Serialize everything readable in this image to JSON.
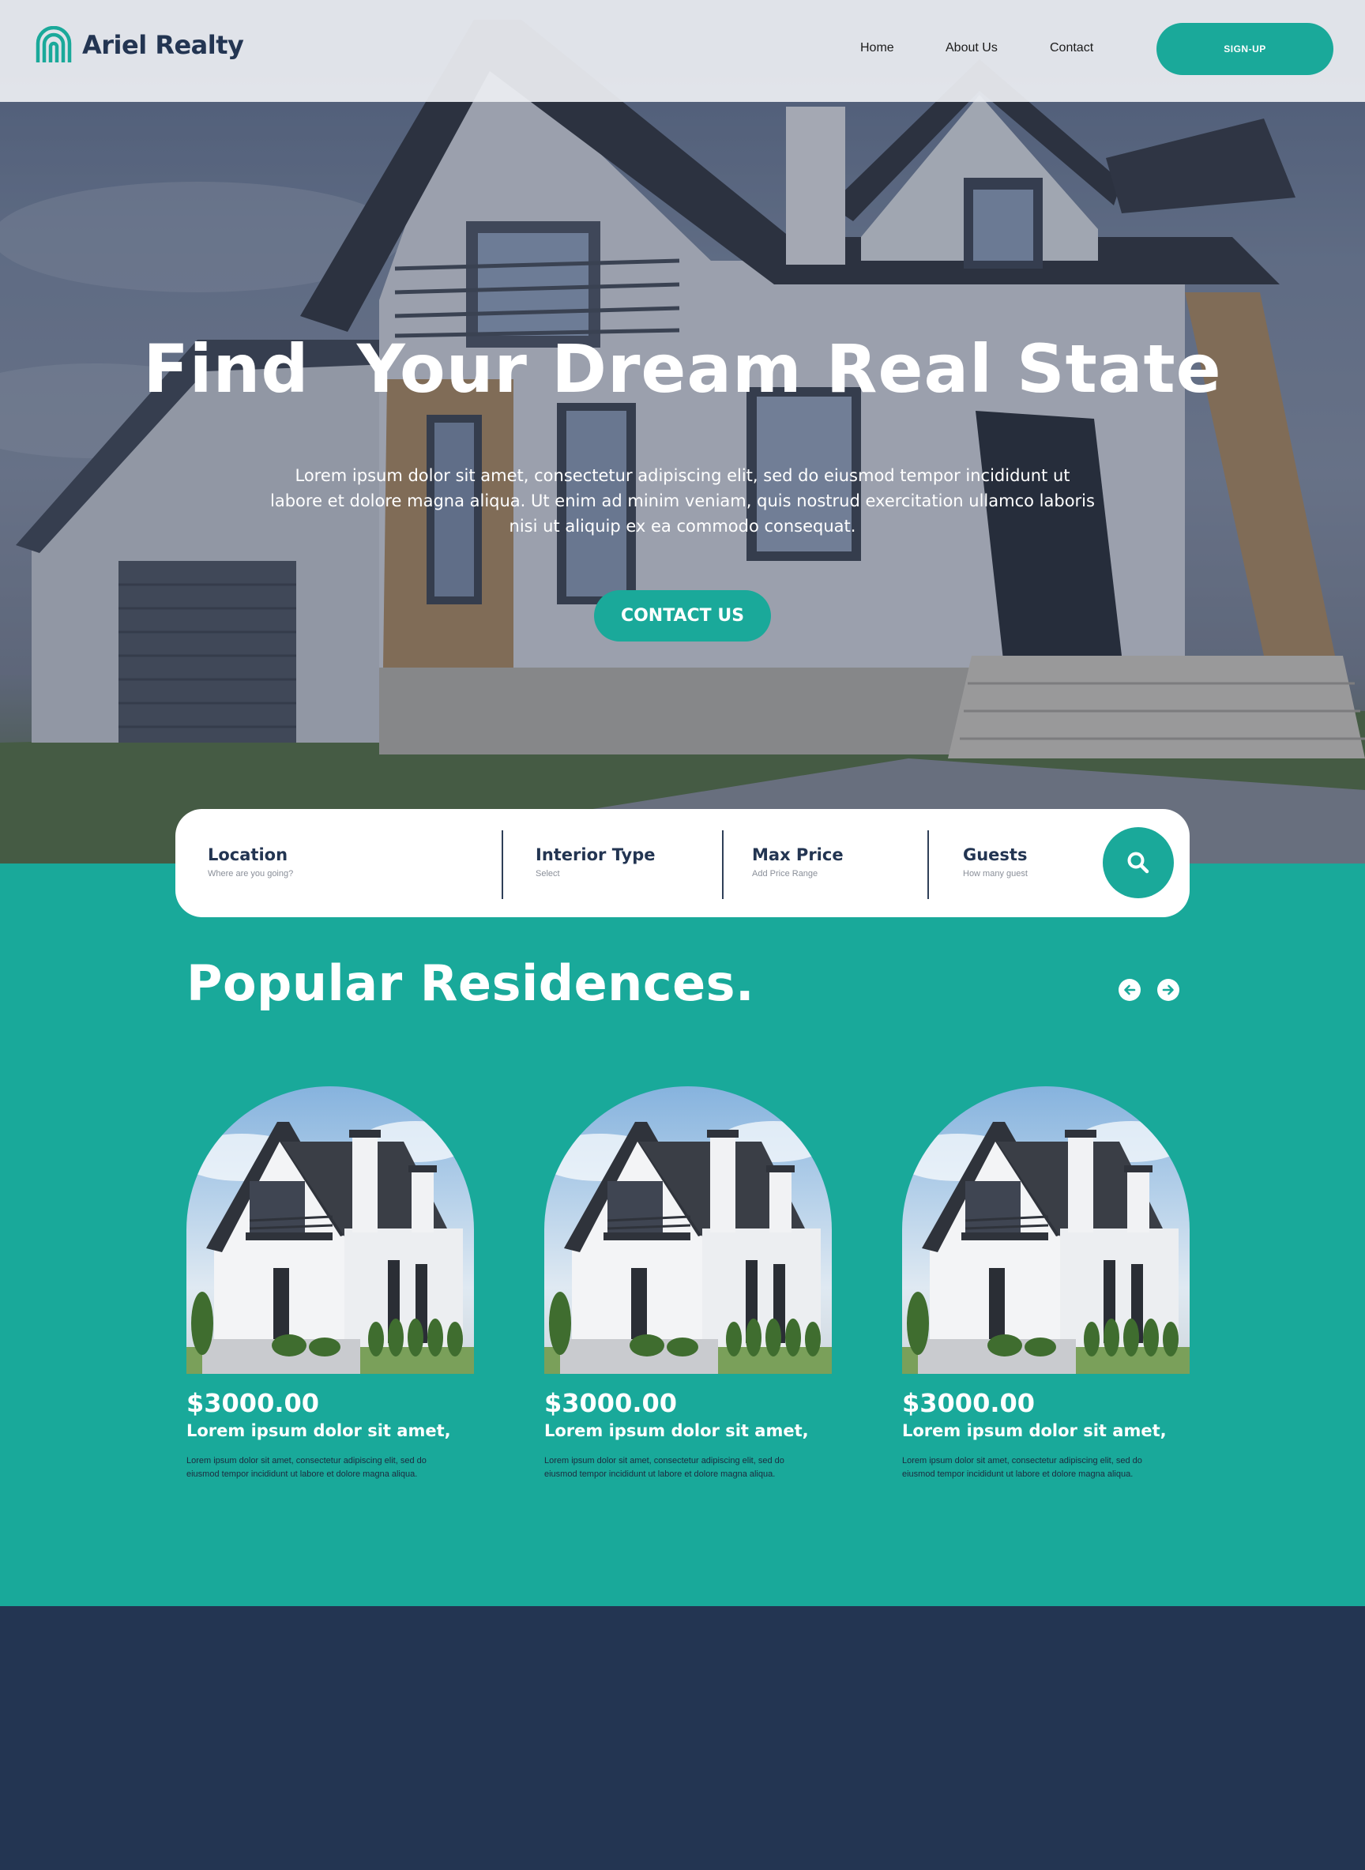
{
  "brand": {
    "name": "Ariel Realty",
    "accent": "#1aa99a",
    "navy": "#233552"
  },
  "nav": {
    "home": "Home",
    "about": "About Us",
    "contact": "Contact",
    "signup": "SIGN-UP"
  },
  "hero": {
    "title": "Find  Your Dream Real State",
    "subtitle": "Lorem ipsum dolor sit amet, consectetur adipiscing elit, sed do eiusmod tempor incididunt ut labore et dolore magna aliqua. Ut enim ad minim veniam, quis nostrud exercitation ullamco laboris nisi ut aliquip ex ea commodo consequat.",
    "cta": "CONTACT US"
  },
  "search": {
    "fields": [
      {
        "label": "Location",
        "hint": "Where are you going?"
      },
      {
        "label": "Interior Type",
        "hint": "Select"
      },
      {
        "label": "Max Price",
        "hint": "Add Price Range"
      },
      {
        "label": "Guests",
        "hint": "How many guest"
      }
    ],
    "button_icon": "search-icon"
  },
  "popular": {
    "title": "Popular Residences.",
    "prev_icon": "arrow-left-circle-icon",
    "next_icon": "arrow-right-circle-icon",
    "cards": [
      {
        "price": "$3000.00",
        "title": "Lorem ipsum dolor sit amet,",
        "description": "Lorem ipsum dolor sit amet, consectetur adipiscing elit, sed do eiusmod tempor incididunt ut labore et dolore magna aliqua."
      },
      {
        "price": "$3000.00",
        "title": "Lorem ipsum dolor sit amet,",
        "description": "Lorem ipsum dolor sit amet, consectetur adipiscing elit, sed do eiusmod tempor incididunt ut labore et dolore magna aliqua."
      },
      {
        "price": "$3000.00",
        "title": "Lorem ipsum dolor sit amet,",
        "description": "Lorem ipsum dolor sit amet, consectetur adipiscing elit, sed do eiusmod tempor incididunt ut labore et dolore magna aliqua."
      }
    ]
  }
}
